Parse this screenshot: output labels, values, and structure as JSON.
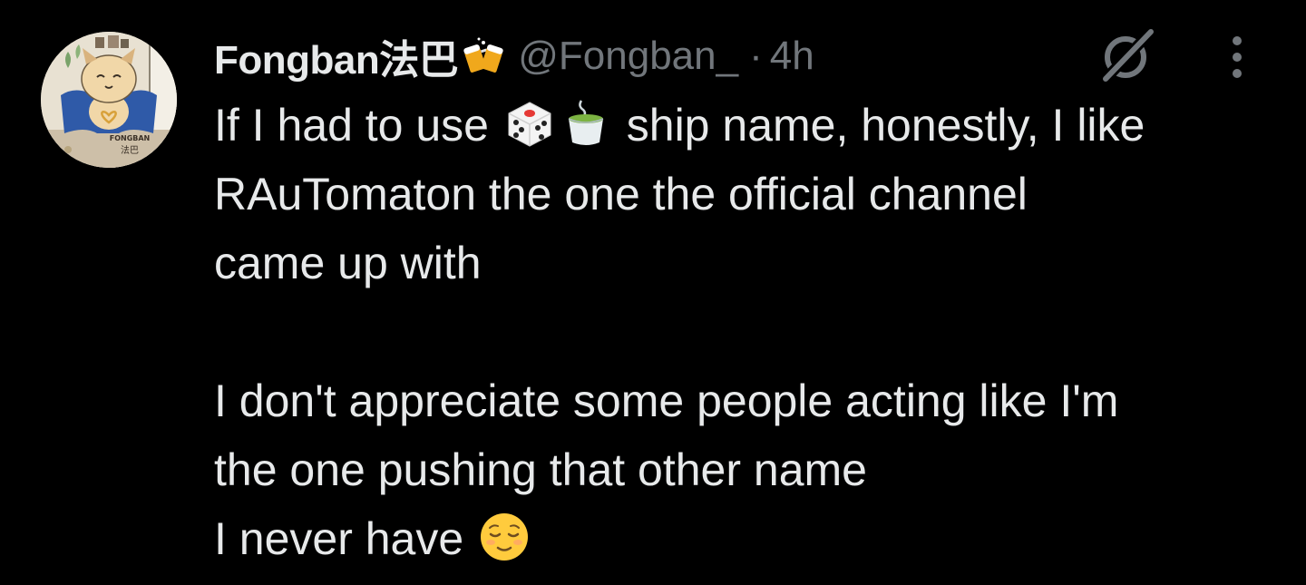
{
  "tweet": {
    "display_name": "Fongban法巴",
    "name_emoji_icon": "clinking-beer-mugs-icon",
    "handle": "@Fongban_",
    "separator": "·",
    "timestamp": "4h",
    "avatar_text": {
      "top": "FONGBAN",
      "bottom": "法巴"
    },
    "body": {
      "line1_a": "If I had to use ",
      "line1_emoji1": "die-icon",
      "line1_emoji2": "teacup-icon",
      "line1_b": " ship name, honestly, I like",
      "line2": "RAuTomaton the one the official channel",
      "line3": "came up with",
      "line4": "",
      "line5": "I don't appreciate some people acting like I'm",
      "line6": "the one pushing that other name",
      "line7_a": "I never have ",
      "line7_emoji": "relieved-face-icon"
    },
    "actions": {
      "grok_icon": "grok-icon",
      "more_icon": "more-vertical-icon"
    }
  },
  "colors": {
    "background": "#000000",
    "primary_text": "#e7e9ea",
    "secondary_text": "#71767b"
  }
}
